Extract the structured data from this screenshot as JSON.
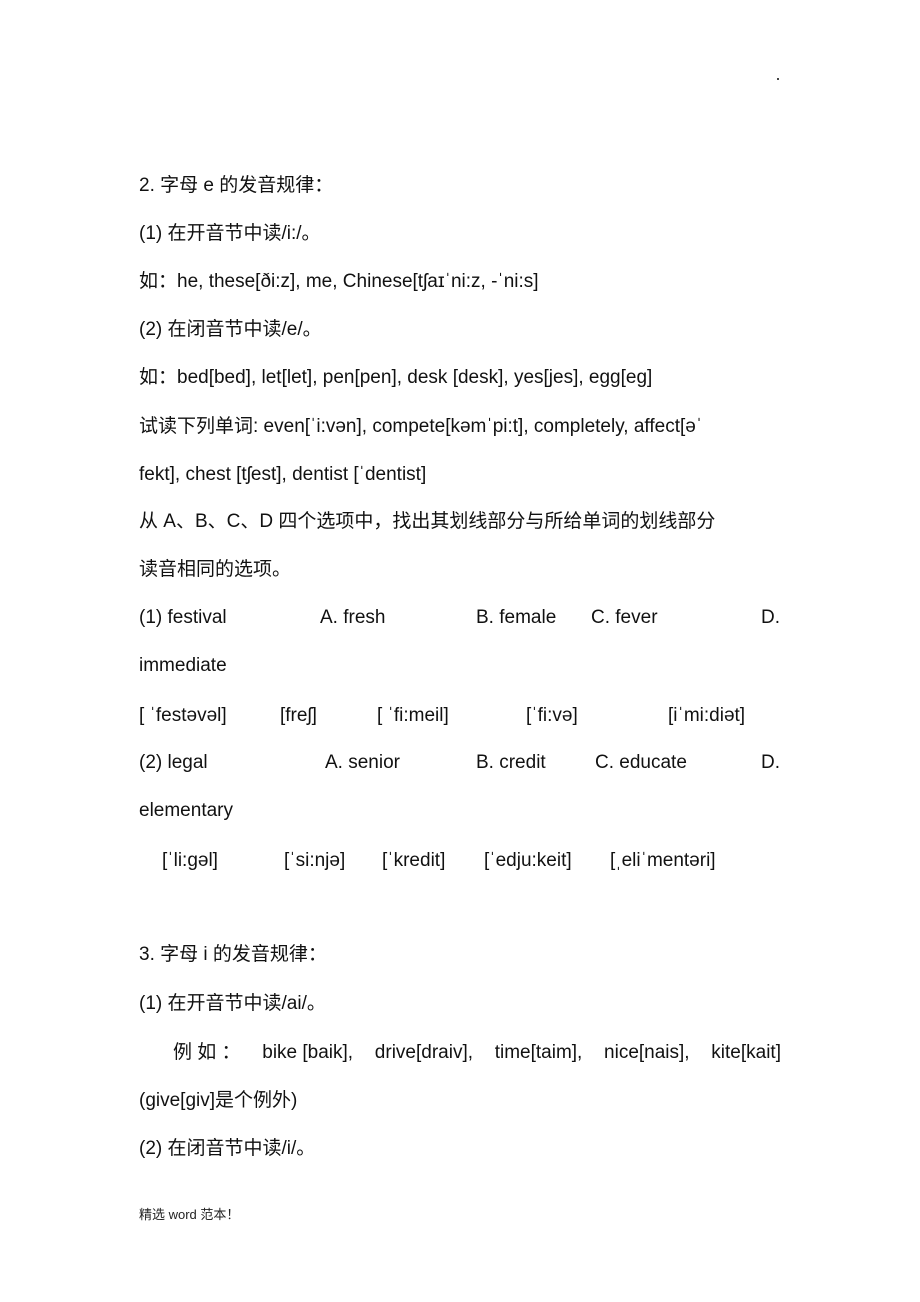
{
  "section2": {
    "heading": "2.  字母 e 的发音规律：",
    "rule1": "(1)  在开音节中读/i:/。",
    "rule1_examples": "如：he, these[ði:z], me, Chinese[tʃaɪˈni:z, -ˈni:s]",
    "rule2": "(2)  在闭音节中读/e/。",
    "rule2_examples": "如：bed[bed], let[let], pen[pen], desk [desk], yes[jes], egg[eɡ]",
    "practice_line1": "试读下列单词: even[ˈi:vən], compete[kəmˈpi:t], completely, affect[əˈ",
    "practice_line2": "fekt], chest [tʃest], dentist [ˈdentist]",
    "instruction_line1": "从 A、B、C、D 四个选项中，找出其划线部分与所给单词的划线部分",
    "instruction_line2": "读音相同的选项。",
    "questions": [
      {
        "stem": "(1) festival",
        "options": [
          "A. fresh",
          "B. female",
          "C. fever",
          "D."
        ],
        "wrap": "immediate",
        "phonetics": [
          "[ ˈfestəvəl]",
          "[freʃ]",
          "[ ˈfi:meil]",
          "[ˈfi:və]",
          "[iˈmi:diət]"
        ]
      },
      {
        "stem": "(2) legal",
        "options": [
          "A. senior",
          "B. credit",
          "C. educate",
          "D."
        ],
        "wrap": "elementary",
        "phonetics": [
          "[ˈli:ɡəl]",
          "[ˈsi:njə]",
          "[ˈkredit]",
          "[ˈedju:keit]",
          "[ˌeliˈmentəri]"
        ]
      }
    ]
  },
  "section3": {
    "heading": "3.  字母 i 的发音规律：",
    "rule1": "(1)  在开音节中读/ai/。",
    "rule1_examples": [
      "例 如 ：",
      "bike  [baik],",
      "drive[draiv],",
      "time[taim],",
      "nice[nais],",
      "kite[kait]"
    ],
    "rule1_exception": "(give[ɡiv]是个例外)",
    "rule2": "(2)  在闭音节中读/i/。"
  },
  "footer": {
    "text": "精选 word 范本！"
  }
}
